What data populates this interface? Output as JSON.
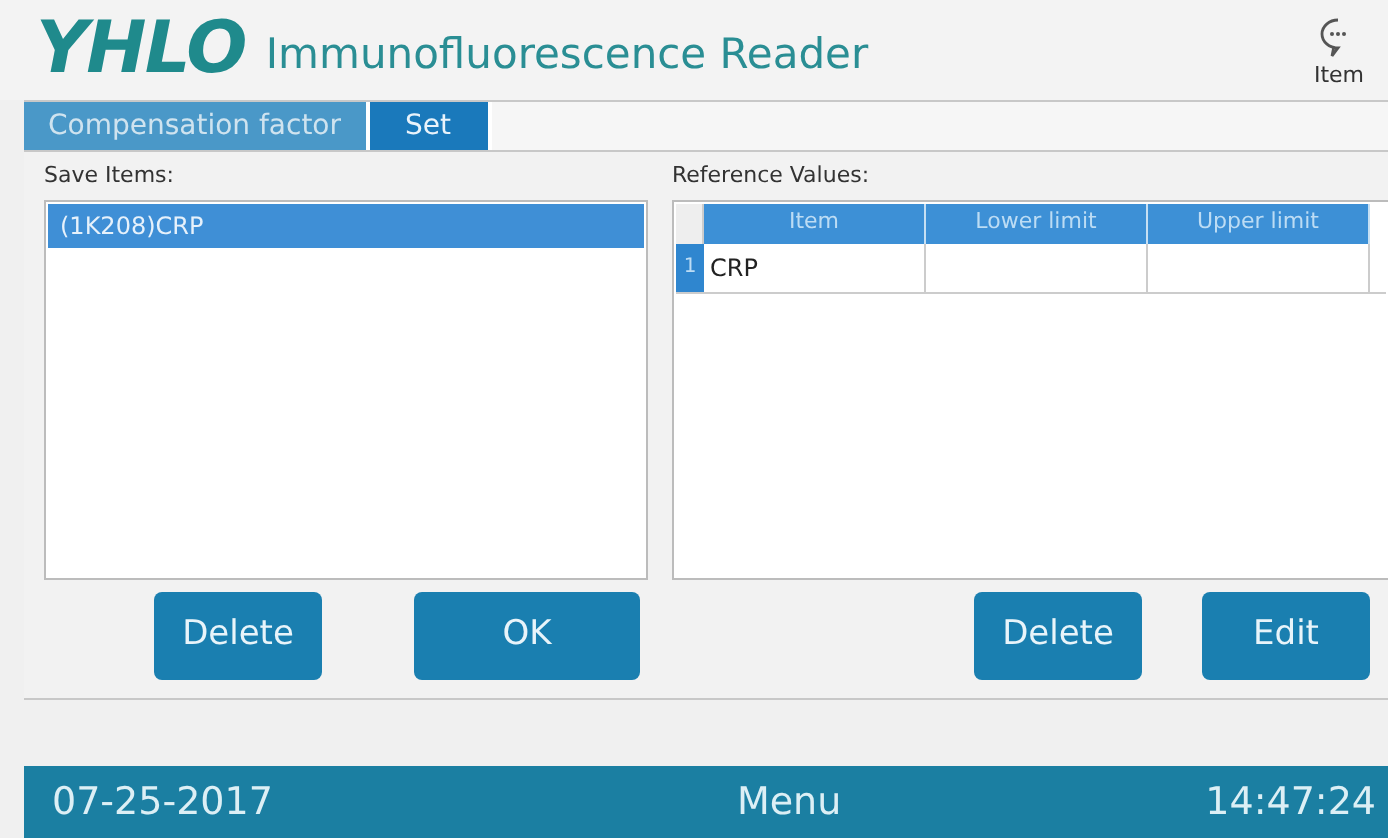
{
  "header": {
    "logo": "YHLO",
    "title": "Immunofluorescence Reader",
    "item_button": "Item"
  },
  "tabs": [
    {
      "label": "Compensation factor",
      "selected": false
    },
    {
      "label": "Set",
      "selected": true
    }
  ],
  "save_items": {
    "label": "Save Items:",
    "items": [
      {
        "text": "(1K208)CRP",
        "selected": true
      }
    ]
  },
  "reference_values": {
    "label": "Reference Values:",
    "columns": [
      "Item",
      "Lower limit",
      "Upper limit"
    ],
    "rows": [
      {
        "number": "1",
        "cells": [
          "CRP",
          "",
          ""
        ]
      }
    ]
  },
  "left_buttons": [
    "Delete",
    "OK"
  ],
  "right_buttons": [
    "Delete",
    "Edit"
  ],
  "status_bar": {
    "date": "07-25-2017",
    "menu": "Menu",
    "time": "14:47:24"
  }
}
